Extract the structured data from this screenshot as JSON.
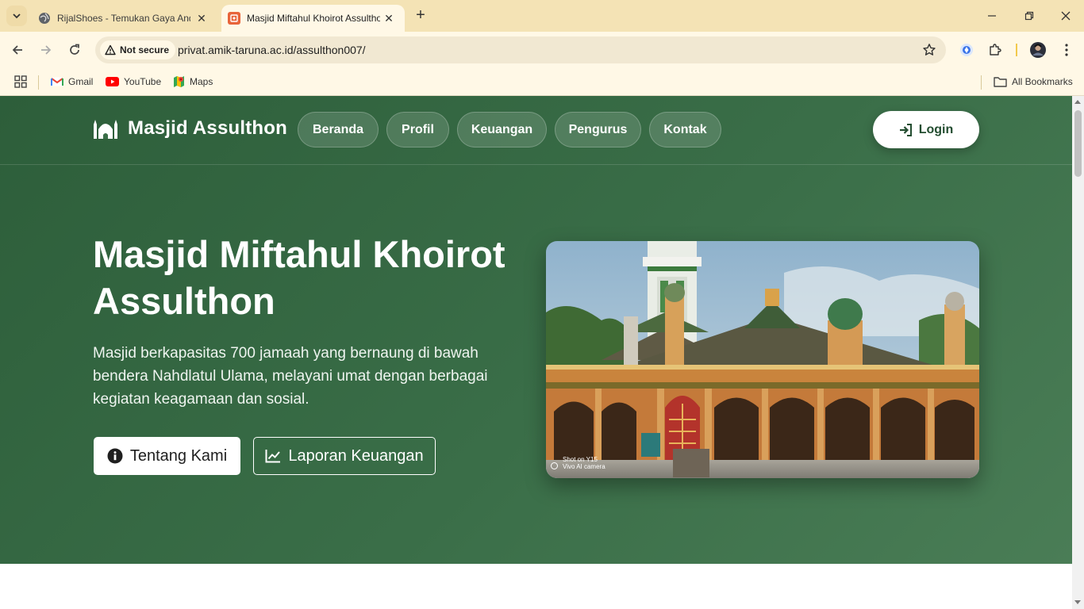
{
  "browser": {
    "tabs": [
      {
        "title": "RijalShoes - Temukan Gaya Anda",
        "active": false
      },
      {
        "title": "Masjid Miftahul Khoirot Assulthon",
        "active": true
      }
    ],
    "address": {
      "security_label": "Not secure",
      "url": "privat.amik-taruna.ac.id/assulthon007/"
    },
    "bookmarks": [
      {
        "label": "Gmail",
        "icon": "gmail-icon"
      },
      {
        "label": "YouTube",
        "icon": "youtube-icon"
      },
      {
        "label": "Maps",
        "icon": "maps-icon"
      }
    ],
    "all_bookmarks_label": "All Bookmarks"
  },
  "site": {
    "brand": "Masjid Assulthon",
    "nav": [
      {
        "label": "Beranda"
      },
      {
        "label": "Profil"
      },
      {
        "label": "Keuangan"
      },
      {
        "label": "Pengurus"
      },
      {
        "label": "Kontak"
      }
    ],
    "login_label": "Login"
  },
  "hero": {
    "title": "Masjid Miftahul Khoirot Assulthon",
    "description": "Masjid berkapasitas 700 jamaah yang bernaung di bawah bendera Nahdlatul Ulama, melayani umat dengan berbagai kegiatan keagamaan dan sosial.",
    "primary_button": "Tentang Kami",
    "secondary_button": "Laporan Keuangan",
    "image_watermark_line1": "Shot on Y15",
    "image_watermark_line2": "Vivo AI camera"
  },
  "colors": {
    "hero_green": "#3a6e48",
    "tab_strip": "#f4e3b5",
    "toolbar": "#fff8e6"
  }
}
